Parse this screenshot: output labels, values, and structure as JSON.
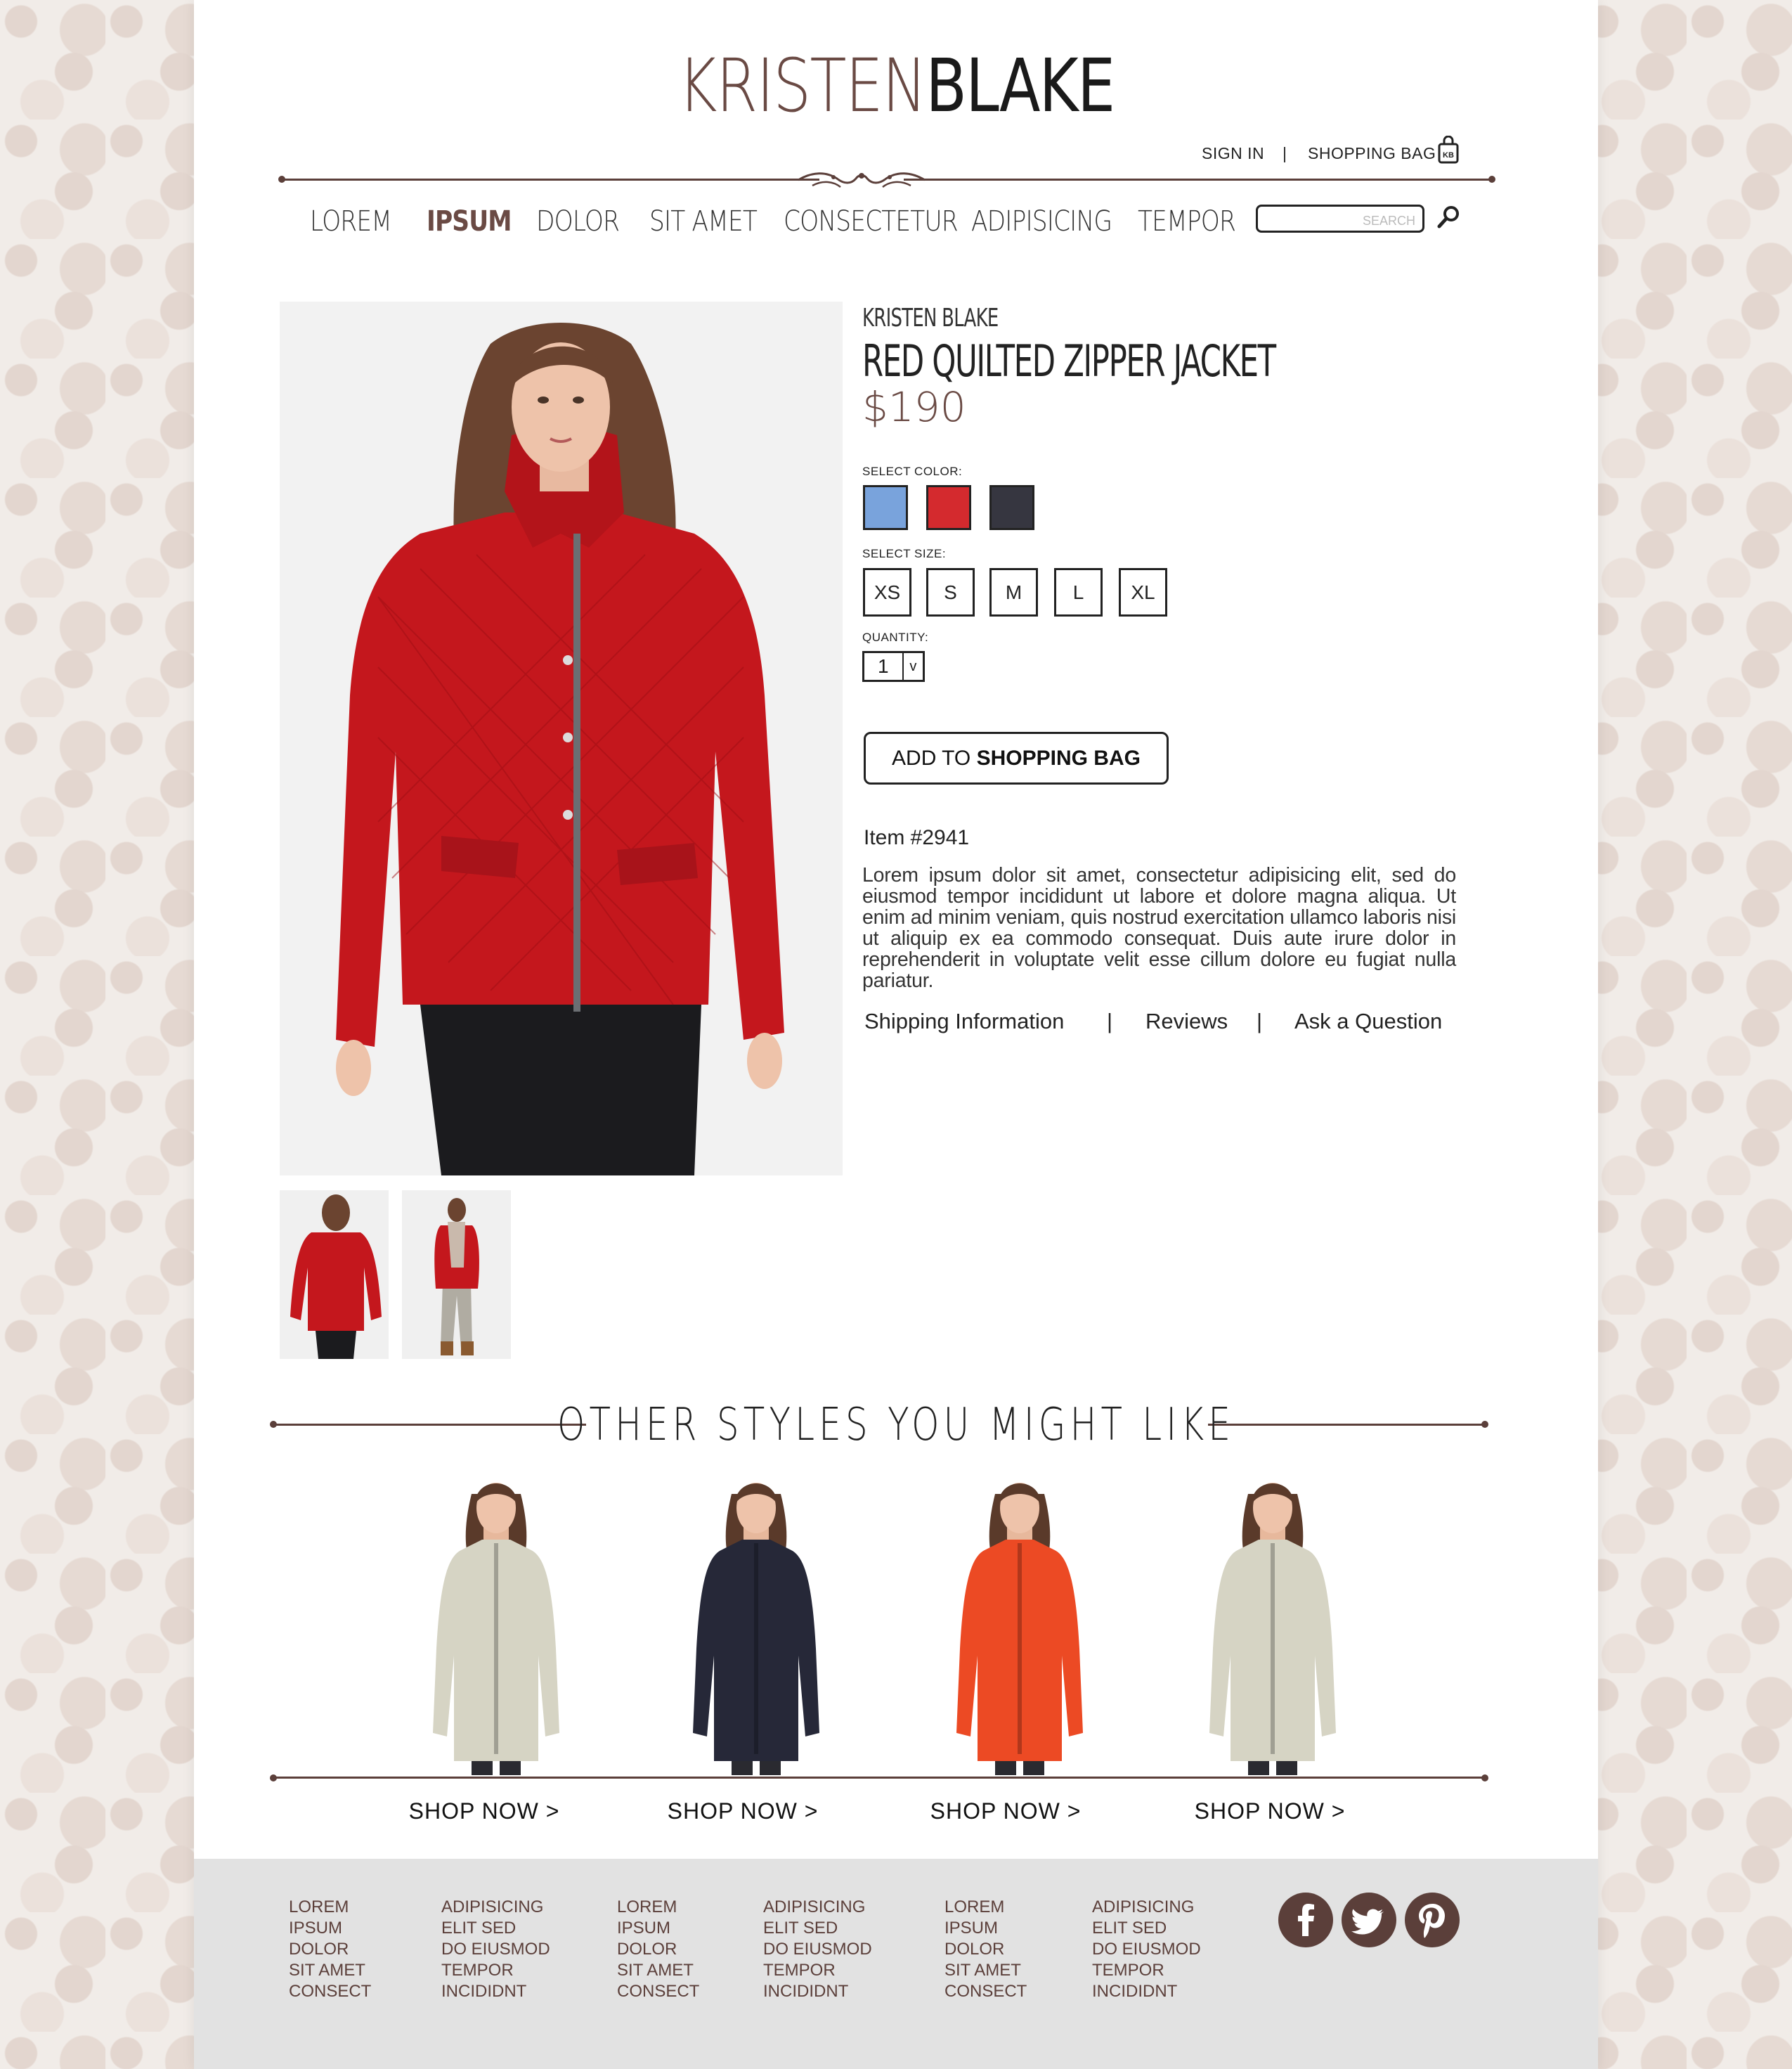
{
  "brand": {
    "first": "KRISTEN",
    "second": "BLAKE"
  },
  "header": {
    "sign_in": "SIGN IN",
    "separator": "|",
    "shopping_bag": "SHOPPING BAG",
    "bag_badge": "KB"
  },
  "nav": {
    "items": [
      "LOREM",
      "IPSUM",
      "DOLOR",
      "SIT AMET",
      "CONSECTETUR",
      "ADIPISICING",
      "TEMPOR"
    ],
    "active": "IPSUM",
    "search_placeholder": "SEARCH"
  },
  "product": {
    "brand": "KRISTEN BLAKE",
    "title": "RED QUILTED ZIPPER JACKET",
    "price": "$190",
    "color_label": "SELECT COLOR:",
    "colors": [
      "#79a3dc",
      "#d42a2e",
      "#363640"
    ],
    "size_label": "SELECT SIZE:",
    "sizes": [
      "XS",
      "S",
      "M",
      "L",
      "XL"
    ],
    "quantity_label": "QUANTITY:",
    "quantity": "1",
    "quantity_caret": "v",
    "add_button_prefix": "ADD TO ",
    "add_button_strong": "SHOPPING BAG",
    "item_number": "Item #2941",
    "description": "Lorem ipsum dolor sit amet, consectetur adipisicing elit, sed do eiusmod tempor incididunt ut labore et dolore magna aliqua. Ut enim ad minim veniam, quis nostrud exercitation ullamco laboris nisi ut aliquip ex ea commodo consequat. Duis aute irure dolor in reprehenderit in voluptate velit esse cillum dolore eu fugiat nulla pariatur.",
    "links": [
      "Shipping Information",
      "Reviews",
      "Ask a Question"
    ],
    "link_separator": "|"
  },
  "recommendations": {
    "title": "OTHER STYLES YOU MIGHT LIKE",
    "cta": "SHOP NOW >",
    "coat_colors": [
      "#d6d4c4",
      "#262838",
      "#ec4a24",
      "#d6d4c4"
    ]
  },
  "footer": {
    "columns": [
      [
        "LOREM",
        "IPSUM",
        "DOLOR",
        "SIT AMET",
        "CONSECT"
      ],
      [
        "ADIPISICING",
        "ELIT SED",
        "DO EIUSMOD",
        "TEMPOR",
        "INCIDIDNT"
      ],
      [
        "LOREM",
        "IPSUM",
        "DOLOR",
        "SIT AMET",
        "CONSECT"
      ],
      [
        "ADIPISICING",
        "ELIT SED",
        "DO EIUSMOD",
        "TEMPOR",
        "INCIDIDNT"
      ],
      [
        "LOREM",
        "IPSUM",
        "DOLOR",
        "SIT AMET",
        "CONSECT"
      ],
      [
        "ADIPISICING",
        "ELIT SED",
        "DO EIUSMOD",
        "TEMPOR",
        "INCIDIDNT"
      ]
    ],
    "social": [
      {
        "icon": "facebook-icon",
        "glyph": "f"
      },
      {
        "icon": "twitter-icon",
        "glyph": "t"
      },
      {
        "icon": "pinterest-icon",
        "glyph": "p"
      }
    ]
  },
  "colors": {
    "accent": "#5b3f3a",
    "brand_brown": "#6a4a44",
    "footer_bg": "#e2e2e2"
  }
}
